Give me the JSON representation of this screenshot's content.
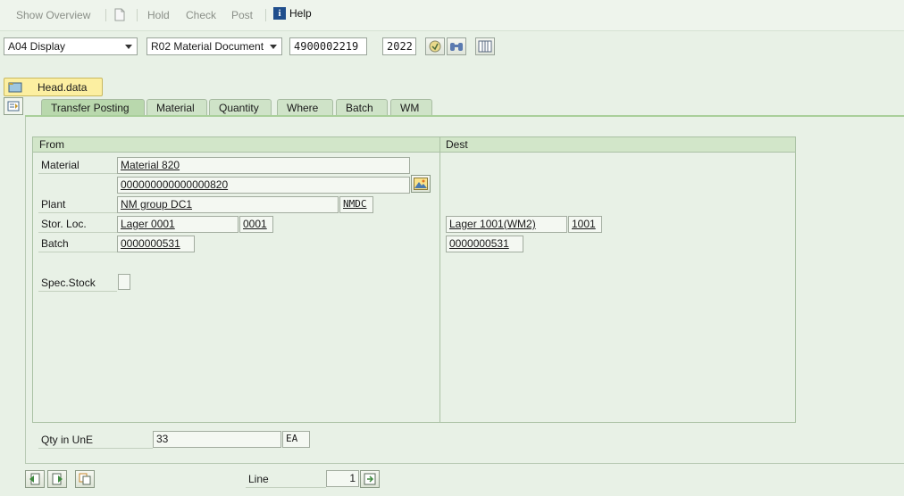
{
  "toolbar": {
    "show_overview": "Show Overview",
    "hold": "Hold",
    "check": "Check",
    "post": "Post",
    "help": "Help"
  },
  "selection": {
    "action": "A04 Display",
    "reference": "R02 Material Document",
    "document_number": "4900002219",
    "year": "2022"
  },
  "head_data_label": "Head.data",
  "tabs": [
    "Transfer Posting",
    "Material",
    "Quantity",
    "Where",
    "Batch",
    "WM"
  ],
  "active_tab": "Transfer Posting",
  "from": {
    "title": "From",
    "material_label": "Material",
    "material_text": "Material 820",
    "material_number": "000000000000000820",
    "plant_label": "Plant",
    "plant_name": "NM group DC1",
    "plant_code": "NMDC",
    "sloc_label": "Stor. Loc.",
    "sloc_name": "Lager 0001",
    "sloc_code": "0001",
    "batch_label": "Batch",
    "batch": "0000000531",
    "spec_stock_label": "Spec.Stock"
  },
  "dest": {
    "title": "Dest",
    "sloc_name": "Lager 1001(WM2)",
    "sloc_code": "1001",
    "batch": "0000000531"
  },
  "qty": {
    "label": "Qty in UnE",
    "value": "33",
    "unit": "EA"
  },
  "line": {
    "label": "Line",
    "value": "1"
  }
}
